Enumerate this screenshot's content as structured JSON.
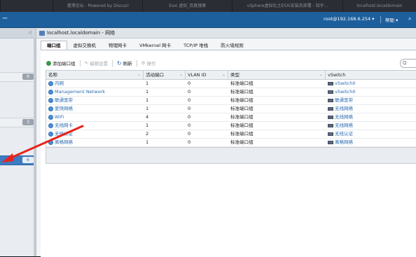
{
  "browser_tabs": [
    "",
    "灌港论坛 - Powered by Discuz!",
    "Esxi 虚拟_百度搜索",
    "vSphere虚拟化之ESXi安装及部署 - 知乎...",
    "localhost.localdomain"
  ],
  "header": {
    "brand": "ー",
    "user": "root@192.168.6.254 ▾",
    "help": "帮助 ▾",
    "search_icon": "search-icon"
  },
  "nav": {
    "collapse": "◁",
    "badges": [
      "9",
      "3",
      "6"
    ]
  },
  "panel": {
    "title": "localhost.localdomain - 网络",
    "tabs": [
      "端口组",
      "虚拟交换机",
      "物理网卡",
      "VMkernel 网卡",
      "TCP/IP 堆栈",
      "防火墙规则"
    ],
    "active_tab": 0
  },
  "toolbar": {
    "add": "添加端口组",
    "edit": "编辑设置",
    "refresh": "刷新",
    "actions": "操作",
    "search_placeholder": "Q"
  },
  "table": {
    "columns": [
      "名称",
      "活动端口",
      "VLAN ID",
      "类型",
      "vSwitch"
    ],
    "rows": [
      {
        "name": "内网",
        "ports": "1",
        "vlan": "0",
        "type": "标准端口组",
        "vswitch": "vSwitch0"
      },
      {
        "name": "Management Network",
        "ports": "1",
        "vlan": "0",
        "type": "标准端口组",
        "vswitch": "vSwitch0"
      },
      {
        "name": "联通宽带",
        "ports": "1",
        "vlan": "0",
        "type": "标准端口组",
        "vswitch": "联通宽带"
      },
      {
        "name": "爱快网络",
        "ports": "1",
        "vlan": "0",
        "type": "标准端口组",
        "vswitch": "无线网络"
      },
      {
        "name": "WiFi",
        "ports": "4",
        "vlan": "0",
        "type": "标准端口组",
        "vswitch": "无线网络"
      },
      {
        "name": "无线网卡",
        "ports": "1",
        "vlan": "0",
        "type": "标准端口组",
        "vswitch": "无线网络"
      },
      {
        "name": "无线认证",
        "ports": "2",
        "vlan": "0",
        "type": "标准端口组",
        "vswitch": "无线认证"
      },
      {
        "name": "离格网络",
        "ports": "1",
        "vlan": "0",
        "type": "标准端口组",
        "vswitch": "离格网络"
      }
    ]
  },
  "colors": {
    "accent": "#1d5f9c",
    "link": "#2a6ab3",
    "arrow": "#e8231d"
  }
}
